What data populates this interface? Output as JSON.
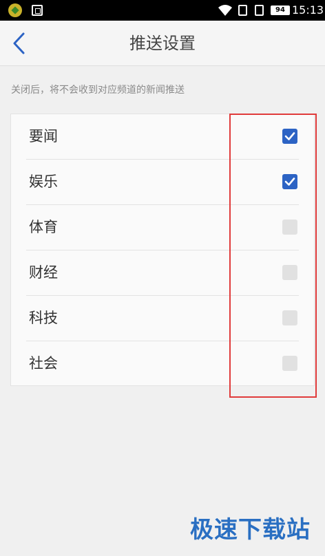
{
  "status_bar": {
    "battery": "94",
    "time": "15:13"
  },
  "header": {
    "title": "推送设置",
    "back_icon": "chevron-left-icon"
  },
  "hint": "关闭后，将不会收到对应频道的新闻推送",
  "channels": [
    {
      "label": "要闻",
      "checked": true
    },
    {
      "label": "娱乐",
      "checked": true
    },
    {
      "label": "体育",
      "checked": false
    },
    {
      "label": "财经",
      "checked": false
    },
    {
      "label": "科技",
      "checked": false
    },
    {
      "label": "社会",
      "checked": false
    }
  ],
  "colors": {
    "accent": "#2c63c4",
    "highlight": "#e03a3a",
    "watermark": "#2a6fc2"
  },
  "watermark": "极速下载站"
}
